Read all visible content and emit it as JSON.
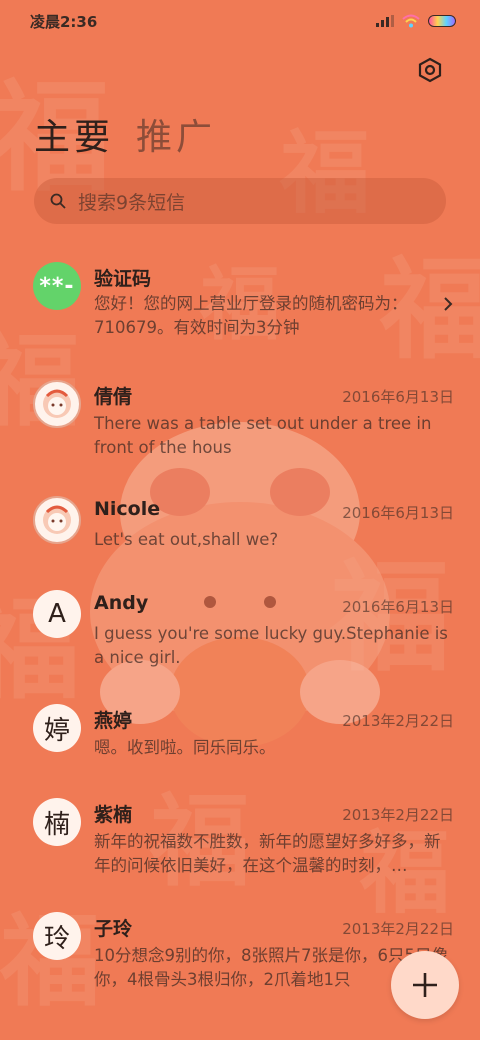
{
  "status_bar": {
    "time": "凌晨2:36"
  },
  "tabs": [
    {
      "label": "主要",
      "active": true
    },
    {
      "label": "推广",
      "active": false
    }
  ],
  "search": {
    "placeholder": "搜索9条短信"
  },
  "messages": [
    {
      "avatar": "**-",
      "sender": "验证码",
      "date": "",
      "preview": "您好！您的网上营业厅登录的随机密码为：710679。有效时间为3分钟"
    },
    {
      "avatar": "lion-avatar",
      "sender": "倩倩",
      "date": "2016年6月13日",
      "preview": "There was a table set out under a tree in front of the hous"
    },
    {
      "avatar": "lion-avatar",
      "sender": "Nicole",
      "date": "2016年6月13日",
      "preview": "Let's eat out,shall we?"
    },
    {
      "avatar": "A",
      "sender": "Andy",
      "date": "2016年6月13日",
      "preview": "I guess you're some lucky guy.Stephanie is a nice girl."
    },
    {
      "avatar": "婷",
      "sender": "燕婷",
      "date": "2013年2月22日",
      "preview": "嗯。收到啦。同乐同乐。"
    },
    {
      "avatar": "楠",
      "sender": "紫楠",
      "date": "2013年2月22日",
      "preview": "新年的祝福数不胜数，新年的愿望好多好多，新年的问候依旧美好，在这个温馨的时刻，…"
    },
    {
      "avatar": "玲",
      "sender": "子玲",
      "date": "2013年2月22日",
      "preview": "10分想念9别的你，8张照片7张是你，6只5只像你，4根骨头3根归你，2爪着地1只"
    }
  ],
  "colors": {
    "background": "#f07a55",
    "accent_green": "#63d36a",
    "fab": "#ffd9c9"
  },
  "icons": {
    "settings": "settings-icon",
    "search": "search-icon",
    "fab": "plus-icon",
    "chevron": "chevron-right-icon"
  }
}
